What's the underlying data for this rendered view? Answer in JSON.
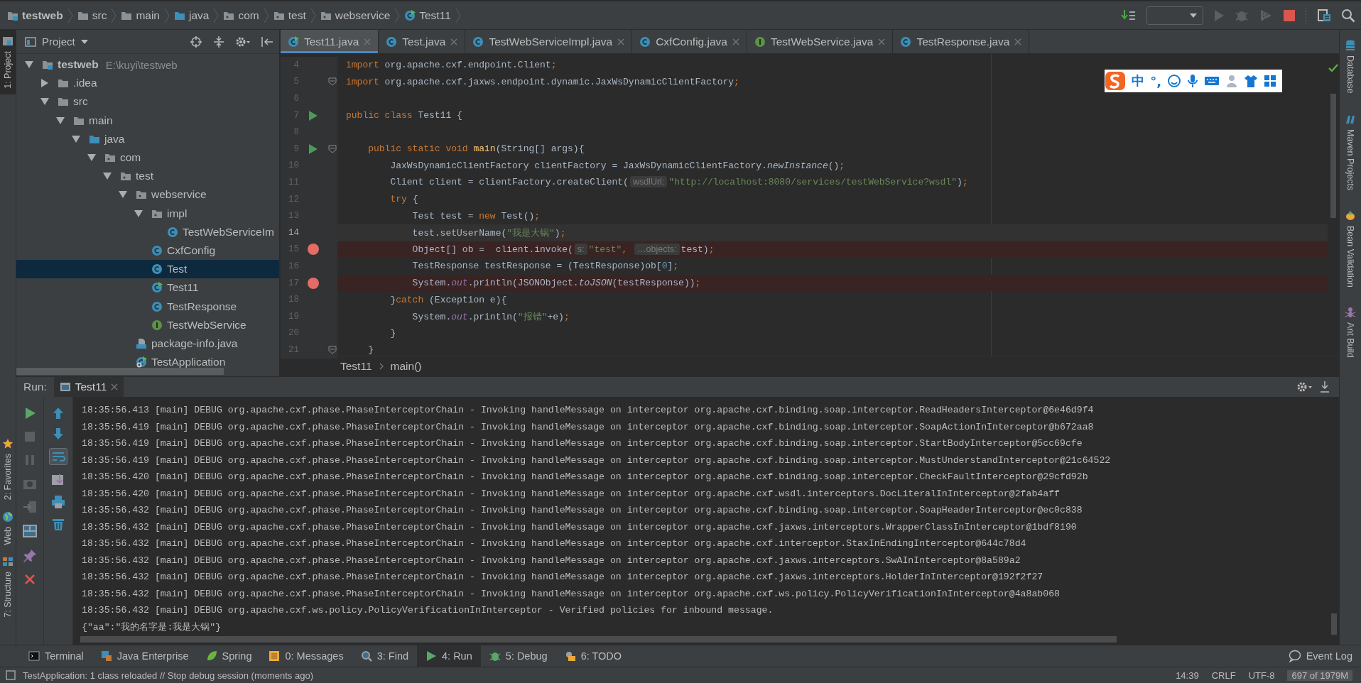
{
  "breadcrumbs": [
    {
      "label": "testweb",
      "kind": "module"
    },
    {
      "label": "src",
      "kind": "folder"
    },
    {
      "label": "main",
      "kind": "folder"
    },
    {
      "label": "java",
      "kind": "source-root"
    },
    {
      "label": "com",
      "kind": "package"
    },
    {
      "label": "test",
      "kind": "package"
    },
    {
      "label": "webservice",
      "kind": "package"
    },
    {
      "label": "Test11",
      "kind": "class-run"
    }
  ],
  "left_strip": [
    {
      "label": "1: Project",
      "kind": "project",
      "selected": true
    },
    {
      "label": "2: Favorites",
      "kind": "star",
      "selected": false
    },
    {
      "label": "Web",
      "kind": "web",
      "selected": false
    },
    {
      "label": "7: Structure",
      "kind": "structure",
      "selected": false
    }
  ],
  "right_strip": [
    {
      "label": "Database",
      "kind": "database"
    },
    {
      "label": "Maven Projects",
      "kind": "maven"
    },
    {
      "label": "Bean Validation",
      "kind": "bean"
    },
    {
      "label": "Ant Build",
      "kind": "ant"
    }
  ],
  "project_panel": {
    "title": "Project",
    "tree": [
      {
        "label": "testweb",
        "path": "E:\\kuyi\\testweb",
        "kind": "module",
        "expanded": true,
        "selected": false,
        "children": [
          {
            "label": ".idea",
            "kind": "folder",
            "expanded": false,
            "selected": false
          },
          {
            "label": "src",
            "kind": "folder",
            "expanded": true,
            "selected": false,
            "children": [
              {
                "label": "main",
                "kind": "folder",
                "expanded": true,
                "selected": false,
                "children": [
                  {
                    "label": "java",
                    "kind": "source-root",
                    "expanded": true,
                    "selected": false,
                    "children": [
                      {
                        "label": "com",
                        "kind": "package",
                        "expanded": true,
                        "selected": false,
                        "children": [
                          {
                            "label": "test",
                            "kind": "package",
                            "expanded": true,
                            "selected": false,
                            "children": [
                              {
                                "label": "webservice",
                                "kind": "package",
                                "expanded": true,
                                "selected": false,
                                "children": [
                                  {
                                    "label": "impl",
                                    "kind": "package",
                                    "expanded": true,
                                    "selected": false,
                                    "children": [
                                      {
                                        "label": "TestWebServiceIm",
                                        "kind": "class",
                                        "selected": false
                                      }
                                    ]
                                  },
                                  {
                                    "label": "CxfConfig",
                                    "kind": "class",
                                    "selected": false
                                  },
                                  {
                                    "label": "Test",
                                    "kind": "class",
                                    "selected": true
                                  },
                                  {
                                    "label": "Test11",
                                    "kind": "class-run",
                                    "selected": false
                                  },
                                  {
                                    "label": "TestResponse",
                                    "kind": "class",
                                    "selected": false
                                  },
                                  {
                                    "label": "TestWebService",
                                    "kind": "interface",
                                    "selected": false
                                  }
                                ]
                              },
                              {
                                "label": "package-info.java",
                                "kind": "java-file",
                                "selected": false
                              },
                              {
                                "label": "TestApplication",
                                "kind": "spring-app",
                                "selected": false
                              }
                            ]
                          }
                        ]
                      }
                    ]
                  }
                ]
              }
            ]
          }
        ]
      }
    ]
  },
  "editor_tabs": [
    {
      "label": "Test11.java",
      "kind": "class-run",
      "selected": true
    },
    {
      "label": "Test.java",
      "kind": "class",
      "selected": false
    },
    {
      "label": "TestWebServiceImpl.java",
      "kind": "class",
      "selected": false
    },
    {
      "label": "CxfConfig.java",
      "kind": "class",
      "selected": false
    },
    {
      "label": "TestWebService.java",
      "kind": "interface",
      "selected": false
    },
    {
      "label": "TestResponse.java",
      "kind": "class",
      "selected": false
    }
  ],
  "code_lines": [
    {
      "number": "4",
      "fold": false,
      "current": false,
      "tokens": [
        {
          "kind": "kw",
          "text": "import"
        },
        {
          "kind": "plain",
          "text": " org.apache.cxf.endpoint.Client"
        },
        {
          "kind": "kw",
          "text": ";"
        }
      ]
    },
    {
      "number": "5",
      "fold": true,
      "current": false,
      "tokens": [
        {
          "kind": "kw",
          "text": "import"
        },
        {
          "kind": "plain",
          "text": " org.apache.cxf.jaxws.endpoint.dynamic.JaxWsDynamicClientFactory"
        },
        {
          "kind": "kw",
          "text": ";"
        }
      ]
    },
    {
      "number": "6",
      "fold": false,
      "current": false
    },
    {
      "number": "7",
      "kind": "run",
      "fold": false,
      "current": false,
      "tokens": [
        {
          "kind": "kw",
          "text": "public class"
        },
        {
          "kind": "plain",
          "text": " Test11 {"
        }
      ]
    },
    {
      "number": "8",
      "fold": false,
      "current": false
    },
    {
      "number": "9",
      "kind": "run",
      "fold": true,
      "current": false,
      "tokens": [
        {
          "kind": "kw",
          "text": "    public static void"
        },
        {
          "kind": "decl",
          "text": " main"
        },
        {
          "kind": "plain",
          "text": "(String[] args){"
        }
      ]
    },
    {
      "number": "10",
      "fold": false,
      "current": false,
      "tokens": [
        {
          "kind": "plain",
          "text": "        JaxWsDynamicClientFactory clientFactory = JaxWsDynamicClientFactory."
        },
        {
          "kind": "italic",
          "text": "newInstance"
        },
        {
          "kind": "plain",
          "text": "()"
        },
        {
          "kind": "kw",
          "text": ";"
        }
      ]
    },
    {
      "number": "11",
      "fold": false,
      "current": false,
      "tokens": [
        {
          "kind": "plain",
          "text": "        Client client = clientFactory.createClient("
        },
        {
          "kind": "hint",
          "text": "wsdlUrl:"
        },
        {
          "kind": "str",
          "text": "\"http://localhost:8080/services/testWebService?wsdl\""
        },
        {
          "kind": "plain",
          "text": ")"
        },
        {
          "kind": "kw",
          "text": ";"
        }
      ]
    },
    {
      "number": "12",
      "fold": false,
      "current": false,
      "tokens": [
        {
          "kind": "kw",
          "text": "        try"
        },
        {
          "kind": "plain",
          "text": " {"
        }
      ]
    },
    {
      "number": "13",
      "fold": false,
      "current": false,
      "tokens": [
        {
          "kind": "plain",
          "text": "            Test test = "
        },
        {
          "kind": "kw",
          "text": "new"
        },
        {
          "kind": "plain",
          "text": " Test()"
        },
        {
          "kind": "kw",
          "text": ";"
        }
      ]
    },
    {
      "number": "14",
      "fold": false,
      "current": true,
      "tokens": [
        {
          "kind": "plain",
          "text": "            test.setUserName("
        },
        {
          "kind": "str",
          "text": "\"我是大锅\""
        },
        {
          "kind": "plain",
          "text": ")"
        },
        {
          "kind": "kw",
          "text": ";"
        }
      ]
    },
    {
      "number": "15",
      "kind": "breakpoint",
      "fold": false,
      "current": false,
      "tokens": [
        {
          "kind": "plain",
          "text": "            Object[] ob =  client.invoke("
        },
        {
          "kind": "hint",
          "text": "s:"
        },
        {
          "kind": "str",
          "text": "\"test\""
        },
        {
          "kind": "kw",
          "text": ", "
        },
        {
          "kind": "hint",
          "text": "…objects:"
        },
        {
          "kind": "plain",
          "text": "test)"
        },
        {
          "kind": "kw",
          "text": ";"
        }
      ]
    },
    {
      "number": "16",
      "fold": false,
      "current": false,
      "tokens": [
        {
          "kind": "plain",
          "text": "            TestResponse testResponse = (TestResponse)ob["
        },
        {
          "kind": "num",
          "text": "0"
        },
        {
          "kind": "plain",
          "text": "]"
        },
        {
          "kind": "kw",
          "text": ";"
        }
      ]
    },
    {
      "number": "17",
      "kind": "breakpoint",
      "fold": false,
      "current": false,
      "tokens": [
        {
          "kind": "plain",
          "text": "            System."
        },
        {
          "kind": "field",
          "text": "out"
        },
        {
          "kind": "plain",
          "text": ".println(JSONObject."
        },
        {
          "kind": "italic",
          "text": "toJSON"
        },
        {
          "kind": "plain",
          "text": "(testResponse))"
        },
        {
          "kind": "kw",
          "text": ";"
        }
      ]
    },
    {
      "number": "18",
      "fold": false,
      "current": false,
      "tokens": [
        {
          "kind": "plain",
          "text": "        }"
        },
        {
          "kind": "kw",
          "text": "catch"
        },
        {
          "kind": "plain",
          "text": " (Exception e){"
        }
      ]
    },
    {
      "number": "19",
      "fold": false,
      "current": false,
      "tokens": [
        {
          "kind": "plain",
          "text": "            System."
        },
        {
          "kind": "field",
          "text": "out"
        },
        {
          "kind": "plain",
          "text": ".println("
        },
        {
          "kind": "str",
          "text": "\"报错\""
        },
        {
          "kind": "plain",
          "text": "+e)"
        },
        {
          "kind": "kw",
          "text": ";"
        }
      ]
    },
    {
      "number": "20",
      "fold": false,
      "current": false,
      "tokens": [
        {
          "kind": "plain",
          "text": "        }"
        }
      ]
    },
    {
      "number": "21",
      "fold": true,
      "current": false,
      "tokens": [
        {
          "kind": "plain",
          "text": "    }"
        }
      ]
    }
  ],
  "editor_breadcrumb": [
    "Test11",
    "main()"
  ],
  "ime_bar": {
    "texts": [
      "中",
      "°,"
    ]
  },
  "run_panel": {
    "label": "Run:",
    "tabs": [
      {
        "label": "Test11",
        "selected": true
      }
    ],
    "console": [
      "18:35:56.413 [main] DEBUG org.apache.cxf.phase.PhaseInterceptorChain - Invoking handleMessage on interceptor org.apache.cxf.binding.soap.interceptor.ReadHeadersInterceptor@6e46d9f4",
      "18:35:56.419 [main] DEBUG org.apache.cxf.phase.PhaseInterceptorChain - Invoking handleMessage on interceptor org.apache.cxf.binding.soap.interceptor.SoapActionInInterceptor@b672aa8",
      "18:35:56.419 [main] DEBUG org.apache.cxf.phase.PhaseInterceptorChain - Invoking handleMessage on interceptor org.apache.cxf.binding.soap.interceptor.StartBodyInterceptor@5cc69cfe",
      "18:35:56.419 [main] DEBUG org.apache.cxf.phase.PhaseInterceptorChain - Invoking handleMessage on interceptor org.apache.cxf.binding.soap.interceptor.MustUnderstandInterceptor@21c64522",
      "18:35:56.420 [main] DEBUG org.apache.cxf.phase.PhaseInterceptorChain - Invoking handleMessage on interceptor org.apache.cxf.binding.soap.interceptor.CheckFaultInterceptor@29cfd92b",
      "18:35:56.420 [main] DEBUG org.apache.cxf.phase.PhaseInterceptorChain - Invoking handleMessage on interceptor org.apache.cxf.wsdl.interceptors.DocLiteralInInterceptor@2fab4aff",
      "18:35:56.432 [main] DEBUG org.apache.cxf.phase.PhaseInterceptorChain - Invoking handleMessage on interceptor org.apache.cxf.binding.soap.interceptor.SoapHeaderInterceptor@ec0c838",
      "18:35:56.432 [main] DEBUG org.apache.cxf.phase.PhaseInterceptorChain - Invoking handleMessage on interceptor org.apache.cxf.jaxws.interceptors.WrapperClassInInterceptor@1bdf8190",
      "18:35:56.432 [main] DEBUG org.apache.cxf.phase.PhaseInterceptorChain - Invoking handleMessage on interceptor org.apache.cxf.interceptor.StaxInEndingInterceptor@644c78d4",
      "18:35:56.432 [main] DEBUG org.apache.cxf.phase.PhaseInterceptorChain - Invoking handleMessage on interceptor org.apache.cxf.jaxws.interceptors.SwAInInterceptor@8a589a2",
      "18:35:56.432 [main] DEBUG org.apache.cxf.phase.PhaseInterceptorChain - Invoking handleMessage on interceptor org.apache.cxf.jaxws.interceptors.HolderInInterceptor@192f2f27",
      "18:35:56.432 [main] DEBUG org.apache.cxf.phase.PhaseInterceptorChain - Invoking handleMessage on interceptor org.apache.cxf.ws.policy.PolicyVerificationInInterceptor@4a8ab068",
      "18:35:56.432 [main] DEBUG org.apache.cxf.ws.policy.PolicyVerificationInInterceptor - Verified policies for inbound message.",
      "{\"aa\":\"我的名字是:我是大锅\"}"
    ]
  },
  "bottom_tools": [
    {
      "label": "Terminal",
      "kind": "terminal",
      "selected": false
    },
    {
      "label": "Java Enterprise",
      "kind": "enterprise",
      "selected": false
    },
    {
      "label": "Spring",
      "kind": "spring",
      "selected": false
    },
    {
      "label": "0: Messages",
      "kind": "messages",
      "selected": false
    },
    {
      "label": "3: Find",
      "kind": "find",
      "selected": false
    },
    {
      "label": "4: Run",
      "kind": "run",
      "selected": true
    },
    {
      "label": "5: Debug",
      "kind": "debug",
      "selected": false
    },
    {
      "label": "6: TODO",
      "kind": "todo",
      "selected": false
    }
  ],
  "event_log": "Event Log",
  "status_bar": {
    "message": "TestApplication: 1 class reloaded // Stop debug session (moments ago)",
    "items": [
      "14:39",
      "CRLF",
      "UTF-8",
      "697 of 1979M"
    ]
  }
}
